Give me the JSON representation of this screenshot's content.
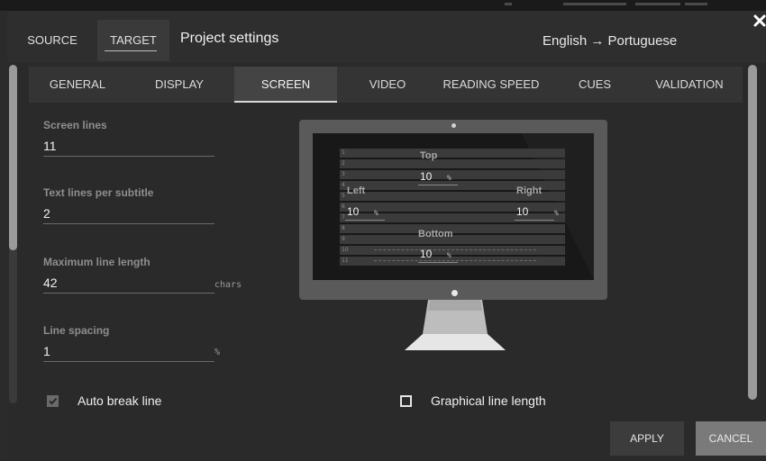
{
  "header": {
    "tabs": [
      "SOURCE",
      "TARGET"
    ],
    "active_tab": "TARGET",
    "title": "Project settings",
    "language_pair": "English → Portuguese"
  },
  "tabs": {
    "items": [
      "GENERAL",
      "DISPLAY",
      "SCREEN",
      "VIDEO",
      "READING SPEED",
      "CUES",
      "VALIDATION"
    ],
    "active": "SCREEN"
  },
  "fields": {
    "screen_lines": {
      "label": "Screen lines",
      "value": "11"
    },
    "text_lines": {
      "label": "Text lines per subtitle",
      "value": "2"
    },
    "max_line_length": {
      "label": "Maximum line length",
      "value": "42",
      "unit": "chars"
    },
    "line_spacing": {
      "label": "Line spacing",
      "value": "1",
      "unit": "%"
    }
  },
  "margins": {
    "top": {
      "label": "Top",
      "value": "10",
      "unit": "%"
    },
    "left": {
      "label": "Left",
      "value": "10",
      "unit": "%"
    },
    "right": {
      "label": "Right",
      "value": "10",
      "unit": "%"
    },
    "bottom": {
      "label": "Bottom",
      "value": "10",
      "unit": "%"
    }
  },
  "screen_line_numbers": [
    "1",
    "2",
    "3",
    "4",
    "5",
    "6",
    "7",
    "8",
    "9",
    "10",
    "11"
  ],
  "checkboxes": {
    "auto_break": {
      "label": "Auto break line",
      "checked": true
    },
    "graphical_length": {
      "label": "Graphical line length",
      "checked": false
    }
  },
  "buttons": {
    "apply": "APPLY",
    "cancel": "CANCEL"
  },
  "icons": {
    "close": "close-icon",
    "check": "checkbox-checked-icon",
    "box": "checkbox-empty-icon"
  },
  "colors": {
    "background": "#2a2a2a",
    "tab_active": "#444444",
    "monitor": "#5a5a5a"
  }
}
